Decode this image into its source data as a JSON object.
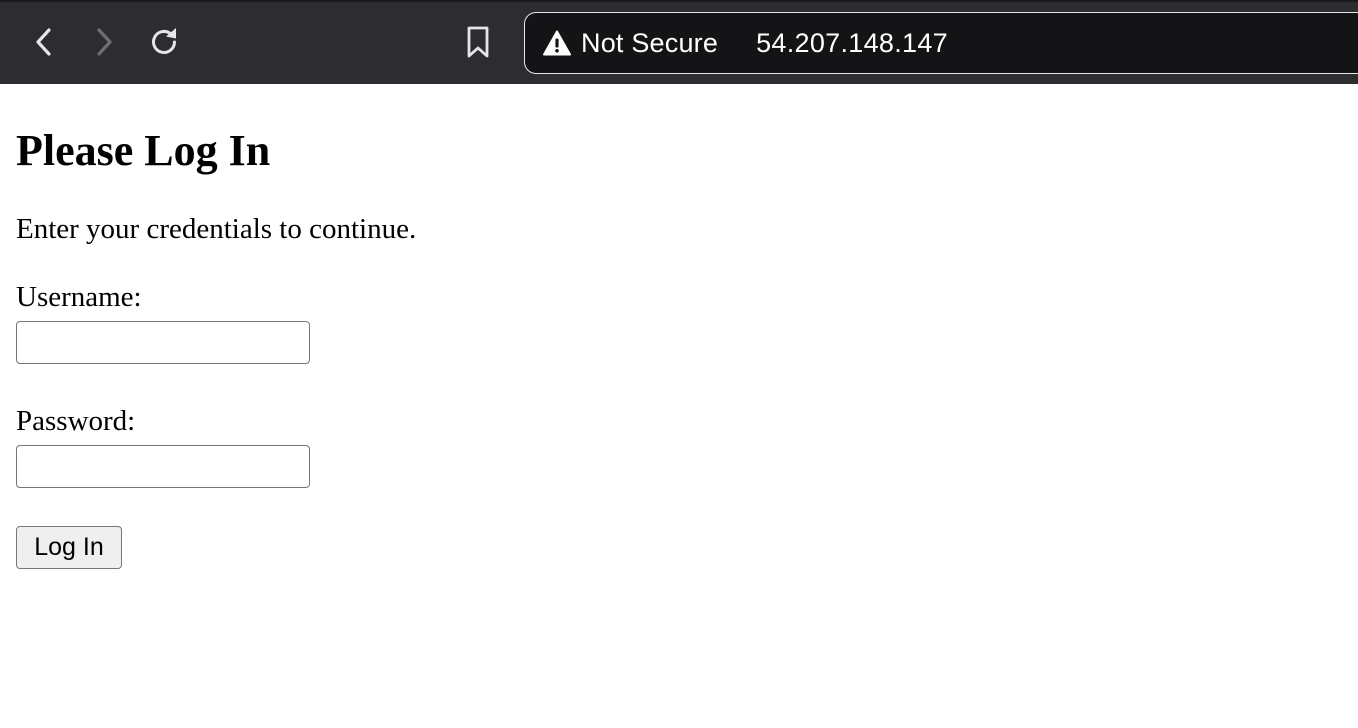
{
  "browser": {
    "security_label": "Not Secure",
    "url": "54.207.148.147",
    "icons": {
      "back": "chevron-left-icon",
      "forward": "chevron-right-icon",
      "reload": "reload-icon",
      "bookmark": "bookmark-icon",
      "security": "warning-triangle-icon"
    },
    "colors": {
      "toolbar_bg": "#2d2d31",
      "address_bg": "#141416",
      "forward_disabled": "#6e6e73"
    }
  },
  "page": {
    "title": "Please Log In",
    "subtitle": "Enter your credentials to continue.",
    "form": {
      "username_label": "Username:",
      "username_value": "",
      "password_label": "Password:",
      "password_value": "",
      "submit_label": "Log In"
    }
  }
}
